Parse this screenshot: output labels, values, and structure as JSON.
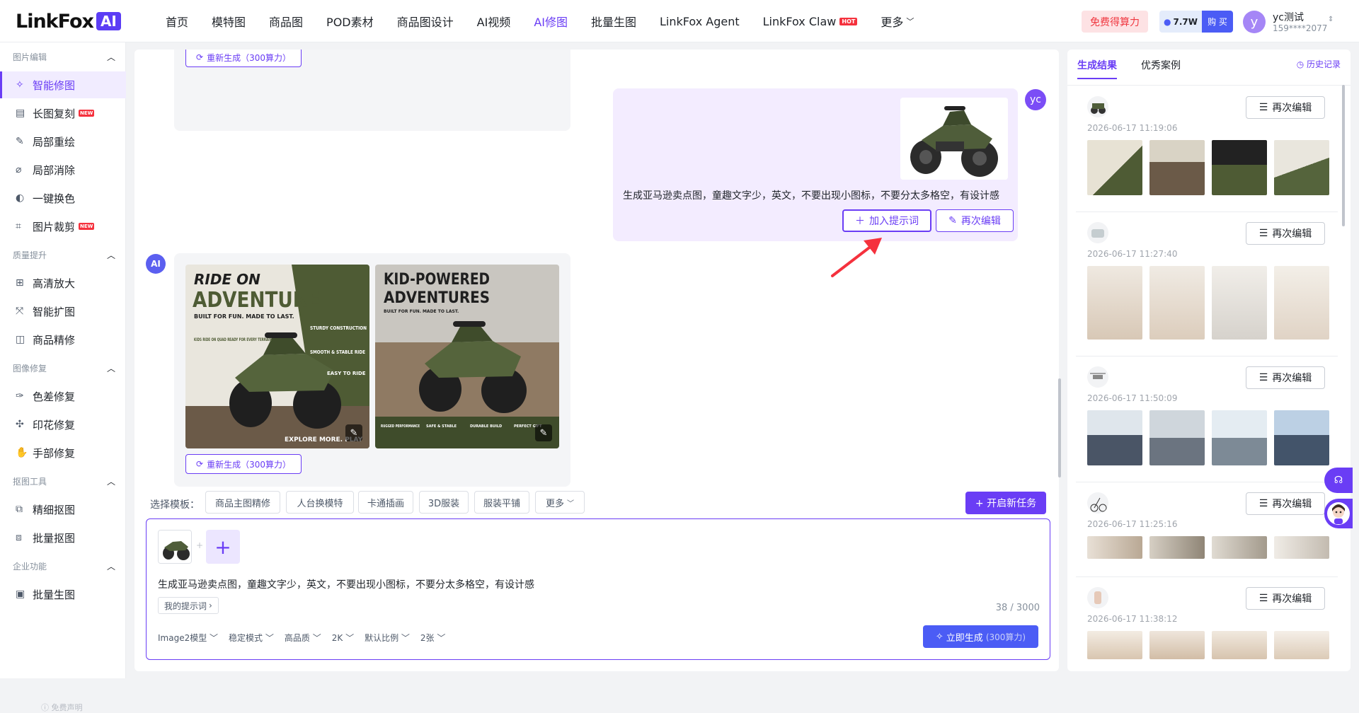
{
  "brand": {
    "name": "LinkFox",
    "badge": "AI"
  },
  "nav": {
    "items": [
      "首页",
      "模特图",
      "商品图",
      "POD素材",
      "商品图设计",
      "AI视频",
      "AI修图",
      "批量生图",
      "LinkFox Agent",
      "LinkFox Claw",
      "更多"
    ],
    "active": "AI修图",
    "hot_badge": "HOT"
  },
  "header": {
    "free_credits": "免费得算力",
    "credits_value": "7.7W",
    "buy": "购 买",
    "avatar_letter": "y",
    "user_name": "yc测试",
    "user_phone": "159****2077"
  },
  "sidebar": {
    "sections": [
      {
        "title": "图片编辑",
        "items": [
          "智能修图",
          "长图复刻",
          "局部重绘",
          "局部消除",
          "一键换色",
          "图片裁剪"
        ]
      },
      {
        "title": "质量提升",
        "items": [
          "高清放大",
          "智能扩图",
          "商品精修"
        ]
      },
      {
        "title": "图像修复",
        "items": [
          "色差修复",
          "印花修复",
          "手部修复"
        ]
      },
      {
        "title": "抠图工具",
        "items": [
          "精细抠图",
          "批量抠图"
        ]
      },
      {
        "title": "企业功能",
        "items": [
          "批量生图"
        ]
      }
    ],
    "active_item": "智能修图",
    "new_badge": "NEW",
    "disclaimer": "免费声明"
  },
  "chat": {
    "regen_label": "重新生成（300算力）",
    "user_avatar": "yc",
    "ai_avatar": "AI",
    "user_prompt": "生成亚马逊卖点图，童趣文字少，英文，不要出现小图标，不要分太多格空，有设计感",
    "add_prompt_label": "加入提示词",
    "re_edit_label": "再次编辑",
    "results": [
      {
        "headline1": "RIDE ON",
        "headline2": "ADVENTURE",
        "tagline": "BUILT FOR FUN. MADE TO LAST.",
        "side_notes": [
          "STURDY CONSTRUCTION",
          "SMOOTH & STABLE RIDE",
          "EASY TO RIDE"
        ],
        "left_note": "KIDS RIDE ON QUAD READY FOR EVERY TERRAIN",
        "footer": "EXPLORE MORE. PLAY"
      },
      {
        "headline1": "KID-POWERED",
        "headline2": "ADVENTURES",
        "tagline": "BUILT FOR FUN. MADE TO LAST.",
        "features": [
          "RUGGED PERFORMANCE",
          "SAFE & STABLE",
          "DURABLE BUILD",
          "PERFECT GIFT"
        ]
      }
    ]
  },
  "templates": {
    "label": "选择模板：",
    "items": [
      "商品主图精修",
      "人台换模特",
      "卡通插画",
      "3D服装",
      "服装平铺",
      "更多"
    ],
    "new_task": "+ 开启新任务"
  },
  "composer": {
    "prompt": "生成亚马逊卖点图，童趣文字少，英文，不要出现小图标，不要分太多格空，有设计感",
    "my_prompts": "我的提示词",
    "counter": "38 / 3000",
    "options": [
      "Image2模型",
      "稳定模式",
      "高品质",
      "2K",
      "默认比例",
      "2张"
    ],
    "generate": "立即生成",
    "generate_cost": "(300算力)"
  },
  "right_panel": {
    "tabs": [
      "生成结果",
      "优秀案例"
    ],
    "history": "历史记录",
    "redo_label": "再次编辑",
    "cards": [
      {
        "date": "2026-06-17 11:19:06",
        "theme": "atv"
      },
      {
        "date": "2026-06-17 11:27:40",
        "theme": "woman"
      },
      {
        "date": "2026-06-17 11:50:09",
        "theme": "drone"
      },
      {
        "date": "2026-06-17 11:25:16",
        "theme": "bike"
      },
      {
        "date": "2026-06-17 11:38:12",
        "theme": "beige"
      }
    ]
  }
}
